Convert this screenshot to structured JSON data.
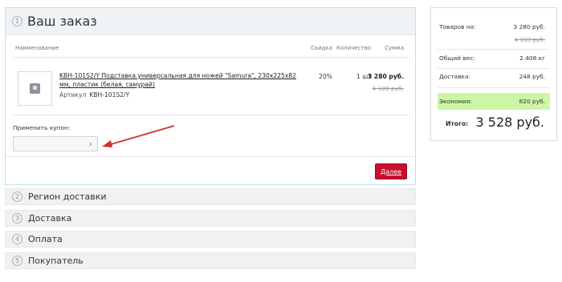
{
  "order": {
    "step": "1",
    "title": "Ваш заказ",
    "columns": {
      "name": "Наименование",
      "discount": "Скидка",
      "quantity": "Количество",
      "sum": "Сумма"
    },
    "item": {
      "name": "KBH-101S2/Y Подставка универсальная для ножей \"Samura\", 230х225х82 мм, пластик (белая, самурай)",
      "sku_label": "Артикул",
      "sku": "KBH-101S2/Y",
      "discount": "20%",
      "quantity": "1 шт",
      "sum": "3 280 руб.",
      "old_sum": "4 100 руб."
    },
    "coupon": {
      "label": "Применить купон:",
      "value": "",
      "arrow": "›"
    },
    "next_label": "Далее"
  },
  "steps": [
    {
      "num": "2",
      "title": "Регион доставки"
    },
    {
      "num": "3",
      "title": "Доставка"
    },
    {
      "num": "4",
      "title": "Оплата"
    },
    {
      "num": "5",
      "title": "Покупатель"
    }
  ],
  "summary": {
    "goods_label": "Товаров на:",
    "goods_value": "3 280 руб.",
    "goods_old": "4 100 руб.",
    "weight_label": "Общий вес:",
    "weight_value": "2.408 кг",
    "delivery_label": "Доставка:",
    "delivery_value": "248 руб.",
    "economy_label": "Экономия:",
    "economy_value": "820 руб.",
    "total_label": "Итого:",
    "total_value": "3 528 руб."
  },
  "colors": {
    "accent_red": "#c8102e",
    "economy_green": "#ccf5a6",
    "border_teal": "#bfe0e6"
  }
}
